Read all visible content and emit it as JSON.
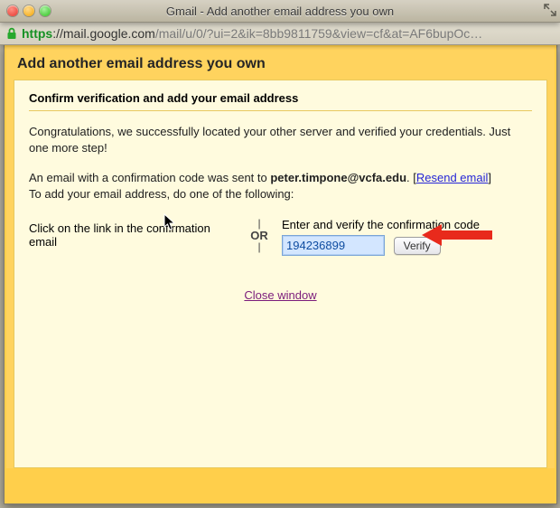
{
  "window": {
    "title": "Gmail - Add another email address you own"
  },
  "urlbar": {
    "scheme": "https",
    "host": "://mail.google.com",
    "rest": "/mail/u/0/?ui=2&ik=8bb9811759&view=cf&at=AF6bupOc…"
  },
  "page": {
    "heading": "Add another email address you own",
    "subheading": "Confirm verification and add your email address",
    "congrats": "Congratulations, we successfully located your other server and verified your credentials. Just one more step!",
    "sent_prefix": "An email with a confirmation code was sent to ",
    "sent_email": "peter.timpone@vcfa.edu",
    "sent_suffix": ".",
    "resend_label": "Resend email",
    "instruction": "To add your email address, do one of the following:",
    "option_left": "Click on the link in the confirmation email",
    "or_label": "OR",
    "option_right_label": "Enter and verify the confirmation code",
    "code_value": "194236899",
    "verify_label": "Verify",
    "close_label": "Close window"
  }
}
